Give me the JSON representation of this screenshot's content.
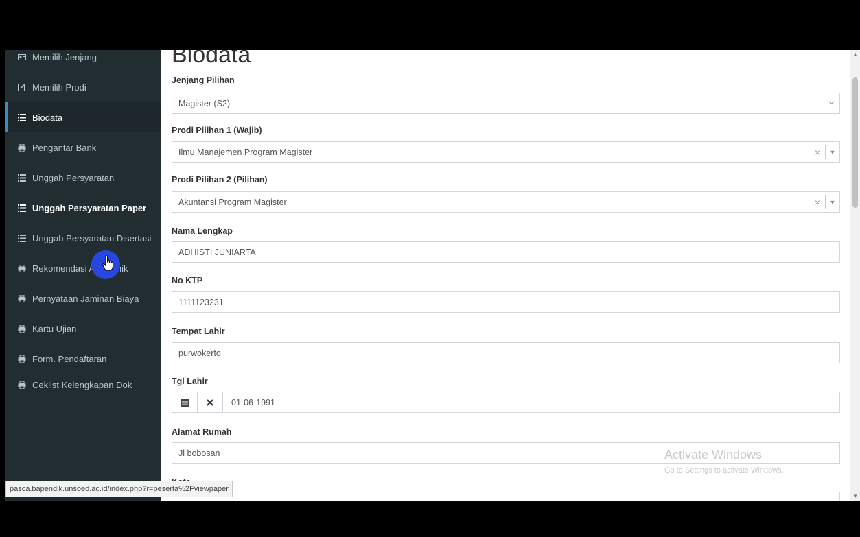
{
  "sidebar": {
    "items": [
      {
        "label": "Memilih Jenjang",
        "icon": "id-card-icon",
        "state": "normal"
      },
      {
        "label": "Memilih Prodi",
        "icon": "edit-icon",
        "state": "normal"
      },
      {
        "label": "Biodata",
        "icon": "list-icon",
        "state": "active"
      },
      {
        "label": "Pengantar Bank",
        "icon": "print-icon",
        "state": "normal"
      },
      {
        "label": "Unggah Persyaratan",
        "icon": "list-icon",
        "state": "normal"
      },
      {
        "label": "Unggah Persyaratan Paper",
        "icon": "list-icon",
        "state": "bold"
      },
      {
        "label": "Unggah Persyaratan Disertasi",
        "icon": "list-icon",
        "state": "normal"
      },
      {
        "label": "Rekomendasi Akademik",
        "icon": "print-icon",
        "state": "normal"
      },
      {
        "label": "Pernyataan Jaminan Biaya",
        "icon": "print-icon",
        "state": "normal"
      },
      {
        "label": "Kartu Ujian",
        "icon": "print-icon",
        "state": "normal"
      },
      {
        "label": "Form. Pendaftaran",
        "icon": "print-icon",
        "state": "normal"
      },
      {
        "label": "Ceklist Kelengkapan Dok",
        "icon": "print-icon",
        "state": "normal"
      }
    ]
  },
  "main": {
    "title": "Biodata",
    "fields": {
      "jenjang": {
        "label": "Jenjang Pilihan",
        "value": "Magister (S2)"
      },
      "prodi1": {
        "label": "Prodi Pilihan 1 (Wajib)",
        "value": "Ilmu Manajemen Program Magister"
      },
      "prodi2": {
        "label": "Prodi Pilihan 2 (Pilihan)",
        "value": "Akuntansi Program Magister"
      },
      "nama": {
        "label": "Nama Lengkap",
        "value": "ADHISTI JUNIARTA"
      },
      "ktp": {
        "label": "No KTP",
        "value": "1111123231"
      },
      "tempat": {
        "label": "Tempat Lahir",
        "value": "purwokerto"
      },
      "tgl": {
        "label": "Tgl Lahir",
        "value": "01-06-1991"
      },
      "alamat": {
        "label": "Alamat Rumah",
        "value": "Jl bobosan"
      },
      "kota": {
        "label": "Kota",
        "value": ""
      }
    },
    "clear_glyph": "×"
  },
  "watermark": {
    "title": "Activate Windows",
    "subtitle": "Go to Settings to activate Windows."
  },
  "status_url": "pasca.bapendik.unsoed.ac.id/index.php?r=peserta%2Fviewpaper",
  "colors": {
    "sidebar_bg": "#222d32",
    "sidebar_text": "#b8c7ce",
    "accent": "#3c8dbc",
    "cursor_highlight": "#2847e0"
  }
}
